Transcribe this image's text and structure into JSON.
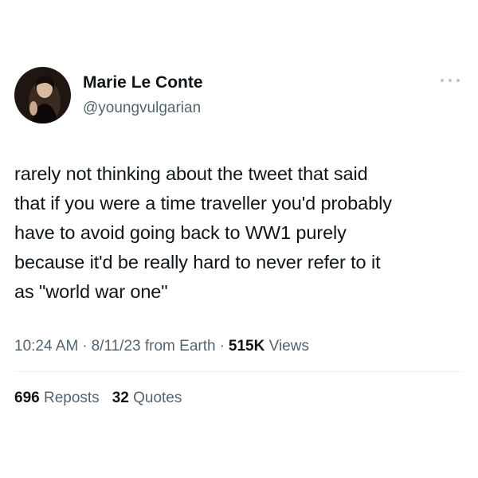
{
  "author": {
    "display_name": "Marie Le Conte",
    "handle": "@youngvulgarian"
  },
  "tweet": {
    "lines": [
      "rarely not thinking about the tweet that said",
      "that if you were a time traveller you'd probably",
      "have to avoid going back to WW1 purely",
      "because it'd be really hard to never refer to it",
      "as \"world war one\""
    ]
  },
  "meta": {
    "time": "10:24 AM",
    "separator": "·",
    "date": "8/11/23",
    "source": "from Earth",
    "views_count": "515K",
    "views_label": "Views"
  },
  "stats": {
    "reposts_count": "696",
    "reposts_label": "Reposts",
    "quotes_count": "32",
    "quotes_label": "Quotes"
  },
  "colors": {
    "text_primary": "#0f1419",
    "text_secondary": "#536471",
    "divider": "#eff3f4"
  },
  "icons": {
    "more": "more-horizontal-icon"
  }
}
